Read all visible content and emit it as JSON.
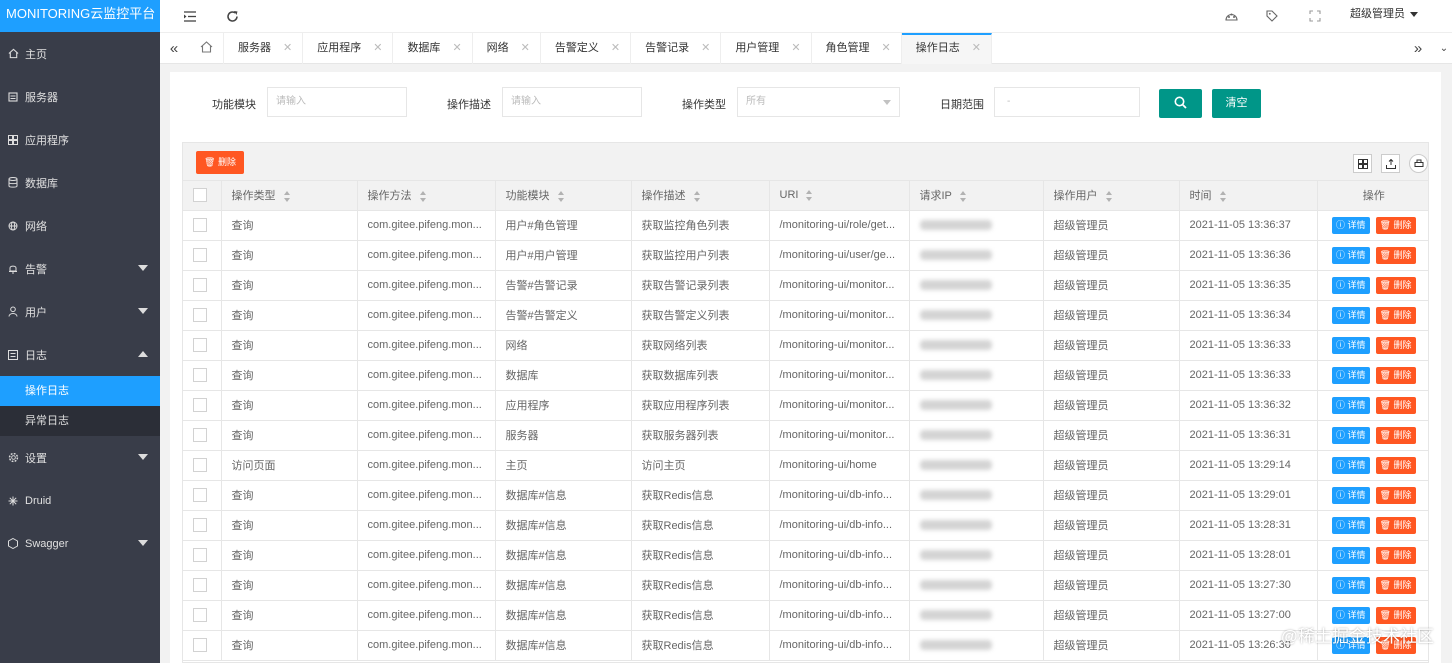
{
  "app": {
    "title": "MONITORING云监控平台"
  },
  "sidebar": {
    "items": [
      {
        "label": "主页",
        "icon": "home-icon"
      },
      {
        "label": "服务器",
        "icon": "server-icon"
      },
      {
        "label": "应用程序",
        "icon": "app-icon"
      },
      {
        "label": "数据库",
        "icon": "database-icon"
      },
      {
        "label": "网络",
        "icon": "globe-icon"
      },
      {
        "label": "告警",
        "icon": "bell-icon"
      },
      {
        "label": "用户",
        "icon": "user-icon"
      },
      {
        "label": "日志",
        "icon": "log-icon"
      },
      {
        "label": "设置",
        "icon": "gear-icon"
      },
      {
        "label": "Druid",
        "icon": "druid-icon"
      },
      {
        "label": "Swagger",
        "icon": "swagger-icon"
      }
    ],
    "log_sub": [
      {
        "label": "操作日志"
      },
      {
        "label": "异常日志"
      }
    ]
  },
  "header": {
    "user": "超级管理员"
  },
  "tabs": [
    {
      "label": "服务器"
    },
    {
      "label": "应用程序"
    },
    {
      "label": "数据库"
    },
    {
      "label": "网络"
    },
    {
      "label": "告警定义"
    },
    {
      "label": "告警记录"
    },
    {
      "label": "用户管理"
    },
    {
      "label": "角色管理"
    },
    {
      "label": "操作日志"
    }
  ],
  "filters": {
    "module_label": "功能模块",
    "module_placeholder": "请输入",
    "desc_label": "操作描述",
    "desc_placeholder": "请输入",
    "type_label": "操作类型",
    "type_value": "所有",
    "date_label": "日期范围",
    "date_value": "-",
    "clear_label": "清空"
  },
  "toolbar": {
    "delete_label": "删除"
  },
  "table": {
    "columns": [
      "操作类型",
      "操作方法",
      "功能模块",
      "操作描述",
      "URI",
      "请求IP",
      "操作用户",
      "时间",
      "操作"
    ],
    "detail_label": "详情",
    "delete_label": "删除",
    "rows": [
      {
        "type": "查询",
        "method": "com.gitee.pifeng.mon...",
        "module": "用户#角色管理",
        "desc": "获取监控角色列表",
        "uri": "/monitoring-ui/role/get...",
        "user": "超级管理员",
        "time": "2021-11-05 13:36:37"
      },
      {
        "type": "查询",
        "method": "com.gitee.pifeng.mon...",
        "module": "用户#用户管理",
        "desc": "获取监控用户列表",
        "uri": "/monitoring-ui/user/ge...",
        "user": "超级管理员",
        "time": "2021-11-05 13:36:36"
      },
      {
        "type": "查询",
        "method": "com.gitee.pifeng.mon...",
        "module": "告警#告警记录",
        "desc": "获取告警记录列表",
        "uri": "/monitoring-ui/monitor...",
        "user": "超级管理员",
        "time": "2021-11-05 13:36:35"
      },
      {
        "type": "查询",
        "method": "com.gitee.pifeng.mon...",
        "module": "告警#告警定义",
        "desc": "获取告警定义列表",
        "uri": "/monitoring-ui/monitor...",
        "user": "超级管理员",
        "time": "2021-11-05 13:36:34"
      },
      {
        "type": "查询",
        "method": "com.gitee.pifeng.mon...",
        "module": "网络",
        "desc": "获取网络列表",
        "uri": "/monitoring-ui/monitor...",
        "user": "超级管理员",
        "time": "2021-11-05 13:36:33"
      },
      {
        "type": "查询",
        "method": "com.gitee.pifeng.mon...",
        "module": "数据库",
        "desc": "获取数据库列表",
        "uri": "/monitoring-ui/monitor...",
        "user": "超级管理员",
        "time": "2021-11-05 13:36:33"
      },
      {
        "type": "查询",
        "method": "com.gitee.pifeng.mon...",
        "module": "应用程序",
        "desc": "获取应用程序列表",
        "uri": "/monitoring-ui/monitor...",
        "user": "超级管理员",
        "time": "2021-11-05 13:36:32"
      },
      {
        "type": "查询",
        "method": "com.gitee.pifeng.mon...",
        "module": "服务器",
        "desc": "获取服务器列表",
        "uri": "/monitoring-ui/monitor...",
        "user": "超级管理员",
        "time": "2021-11-05 13:36:31"
      },
      {
        "type": "访问页面",
        "method": "com.gitee.pifeng.mon...",
        "module": "主页",
        "desc": "访问主页",
        "uri": "/monitoring-ui/home",
        "user": "超级管理员",
        "time": "2021-11-05 13:29:14"
      },
      {
        "type": "查询",
        "method": "com.gitee.pifeng.mon...",
        "module": "数据库#信息",
        "desc": "获取Redis信息",
        "uri": "/monitoring-ui/db-info...",
        "user": "超级管理员",
        "time": "2021-11-05 13:29:01"
      },
      {
        "type": "查询",
        "method": "com.gitee.pifeng.mon...",
        "module": "数据库#信息",
        "desc": "获取Redis信息",
        "uri": "/monitoring-ui/db-info...",
        "user": "超级管理员",
        "time": "2021-11-05 13:28:31"
      },
      {
        "type": "查询",
        "method": "com.gitee.pifeng.mon...",
        "module": "数据库#信息",
        "desc": "获取Redis信息",
        "uri": "/monitoring-ui/db-info...",
        "user": "超级管理员",
        "time": "2021-11-05 13:28:01"
      },
      {
        "type": "查询",
        "method": "com.gitee.pifeng.mon...",
        "module": "数据库#信息",
        "desc": "获取Redis信息",
        "uri": "/monitoring-ui/db-info...",
        "user": "超级管理员",
        "time": "2021-11-05 13:27:30"
      },
      {
        "type": "查询",
        "method": "com.gitee.pifeng.mon...",
        "module": "数据库#信息",
        "desc": "获取Redis信息",
        "uri": "/monitoring-ui/db-info...",
        "user": "超级管理员",
        "time": "2021-11-05 13:27:00"
      },
      {
        "type": "查询",
        "method": "com.gitee.pifeng.mon...",
        "module": "数据库#信息",
        "desc": "获取Redis信息",
        "uri": "/monitoring-ui/db-info...",
        "user": "超级管理员",
        "time": "2021-11-05 13:26:30"
      }
    ]
  },
  "watermark": "@稀土掘金技术社区",
  "colors": {
    "sidebar": "#393d49",
    "accent": "#1e9fff",
    "primary": "#009688",
    "danger": "#ff5722"
  }
}
